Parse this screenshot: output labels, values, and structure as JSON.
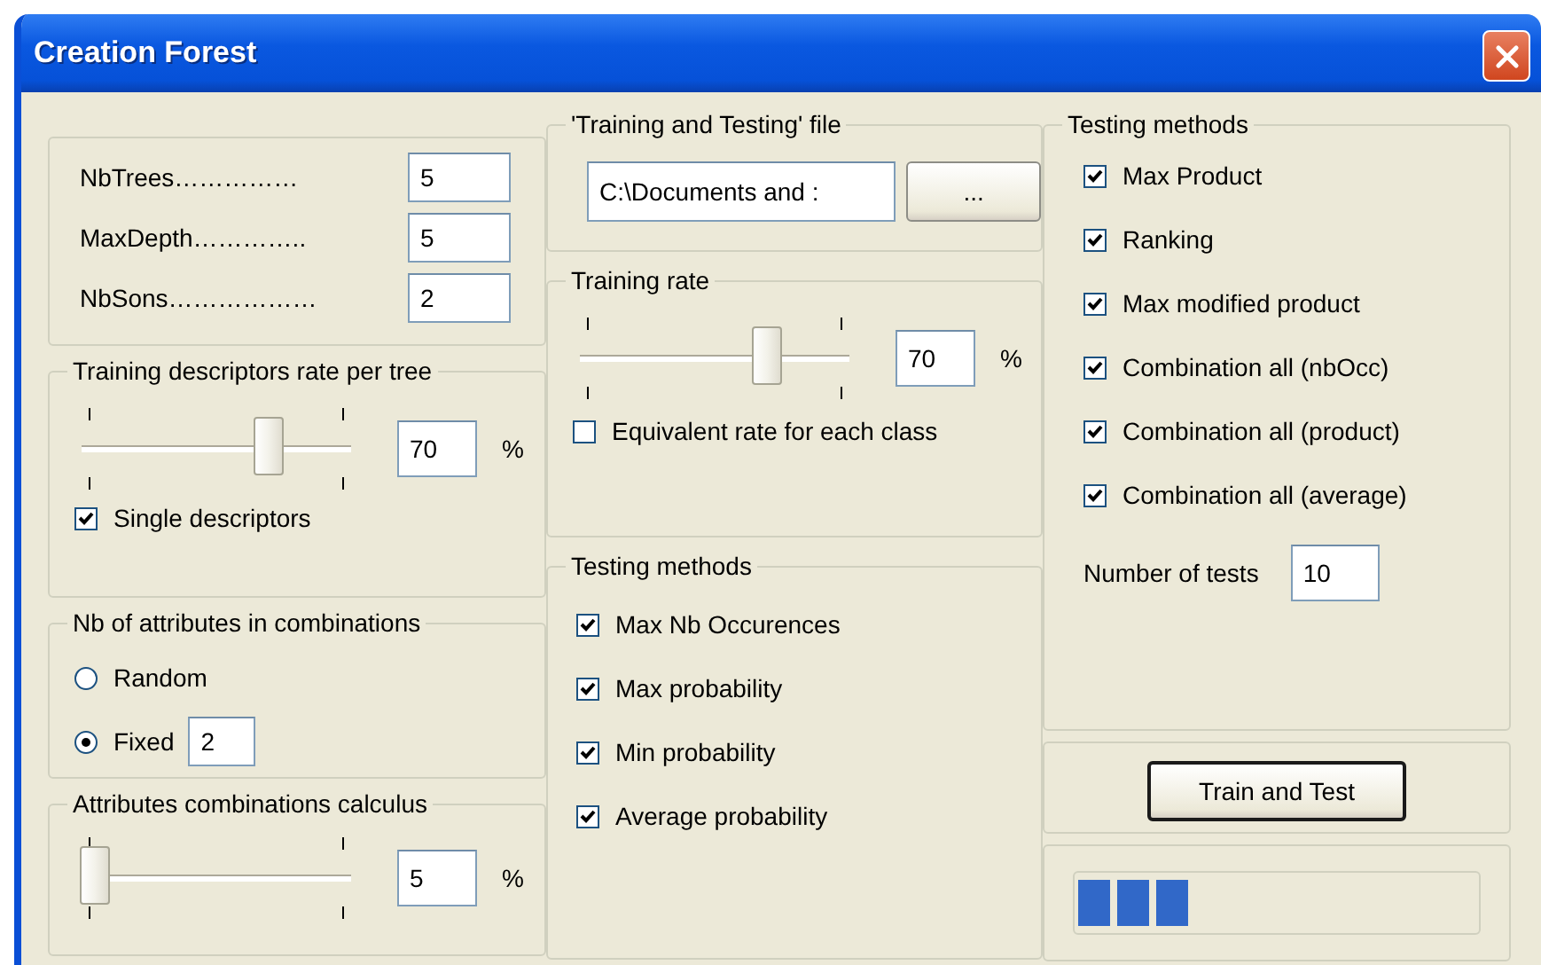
{
  "window": {
    "title": "Creation Forest"
  },
  "columns": [
    [
      {
        "items": [
          {
            "kind": "field",
            "label": "NbTrees……………",
            "value": "5"
          },
          {
            "kind": "field",
            "label": "MaxDepth…………..",
            "value": "5"
          },
          {
            "kind": "field",
            "label": "NbSons………………",
            "value": "2"
          }
        ]
      },
      {
        "legend": "Training descriptors rate per tree",
        "items": [
          {
            "kind": "slider",
            "level": 0.7,
            "value": "70",
            "unit": "%"
          },
          {
            "kind": "checkbox",
            "label": "Single descriptors",
            "checked": true
          }
        ]
      },
      {
        "legend": "Nb of attributes in combinations",
        "items": [
          {
            "kind": "radio",
            "label": "Random",
            "selected": false
          },
          {
            "kind": "radio",
            "label": "Fixed",
            "selected": true,
            "value": "2"
          }
        ]
      },
      {
        "legend": "Attributes combinations calculus",
        "items": [
          {
            "kind": "slider",
            "level": 0.05,
            "value": "5",
            "unit": "%"
          }
        ]
      }
    ],
    [
      {
        "legend": "'Training and Testing' file",
        "items": [
          {
            "kind": "file",
            "value": "C:\\Documents and :",
            "button": "..."
          }
        ]
      },
      {
        "legend": "Training rate",
        "items": [
          {
            "kind": "slider",
            "level": 0.7,
            "value": "70",
            "unit": "%"
          },
          {
            "kind": "checkbox",
            "label": "Equivalent rate for each class",
            "checked": false
          }
        ]
      },
      {
        "legend": "Testing methods",
        "items": [
          {
            "kind": "checkbox",
            "label": "Max Nb Occurences",
            "checked": true
          },
          {
            "kind": "checkbox",
            "label": "Max probability",
            "checked": true
          },
          {
            "kind": "checkbox",
            "label": "Min probability",
            "checked": true
          },
          {
            "kind": "checkbox",
            "label": "Average probability",
            "checked": true
          }
        ]
      }
    ],
    [
      {
        "legend": "Testing methods",
        "items": [
          {
            "kind": "checkbox",
            "label": "Max Product",
            "checked": true
          },
          {
            "kind": "checkbox",
            "label": "Ranking",
            "checked": true
          },
          {
            "kind": "checkbox",
            "label": "Max modified product",
            "checked": true
          },
          {
            "kind": "checkbox",
            "label": "Combination all (nbOcc)",
            "checked": true
          },
          {
            "kind": "checkbox",
            "label": "Combination all (product)",
            "checked": true
          },
          {
            "kind": "checkbox",
            "label": "Combination all (average)",
            "checked": true
          },
          {
            "kind": "number",
            "label": "Number of tests",
            "value": "10"
          }
        ]
      },
      {
        "items": [
          {
            "kind": "button",
            "label": "Train and Test"
          }
        ]
      },
      {
        "items": [
          {
            "kind": "progress",
            "level": 0.28
          }
        ]
      }
    ]
  ]
}
